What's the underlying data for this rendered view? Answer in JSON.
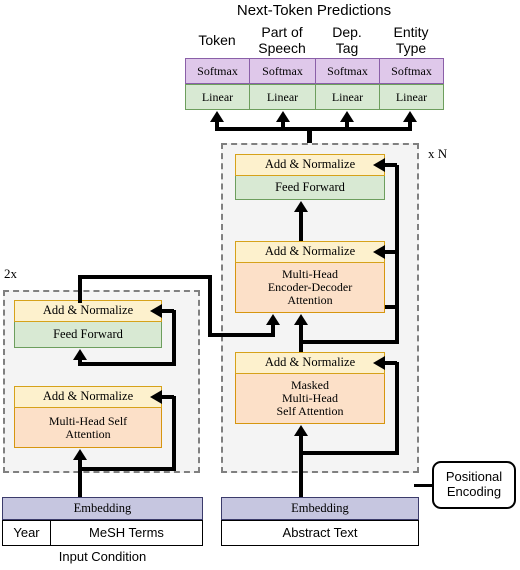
{
  "title": "Next-Token Predictions",
  "output_heads": {
    "columns": [
      {
        "label": "Token",
        "softmax": "Softmax",
        "linear": "Linear"
      },
      {
        "label": "Part of\nSpeech",
        "label_l1": "Part of",
        "label_l2": "Speech",
        "softmax": "Softmax",
        "linear": "Linear"
      },
      {
        "label": "Dep.\nTag",
        "label_l1": "Dep.",
        "label_l2": "Tag",
        "softmax": "Softmax",
        "linear": "Linear"
      },
      {
        "label": "Entity\nType",
        "label_l1": "Entity",
        "label_l2": "Type",
        "softmax": "Softmax",
        "linear": "Linear"
      }
    ]
  },
  "decoder": {
    "repeat_label": "x N",
    "top_block": {
      "addnorm": "Add & Normalize",
      "sub": "Feed Forward"
    },
    "mid_block": {
      "addnorm": "Add & Normalize",
      "sub_l1": "Multi-Head",
      "sub_l2": "Encoder-Decoder",
      "sub_l3": "Attention"
    },
    "bottom_block": {
      "addnorm": "Add & Normalize",
      "sub_l1": "Masked",
      "sub_l2": "Multi-Head",
      "sub_l3": "Self Attention"
    },
    "embedding": "Embedding",
    "input": "Abstract Text"
  },
  "encoder": {
    "repeat_label": "2x",
    "top_block": {
      "addnorm": "Add & Normalize",
      "sub": "Feed Forward"
    },
    "bottom_block": {
      "addnorm": "Add & Normalize",
      "sub_l1": "Multi-Head Self",
      "sub_l2": "Attention"
    },
    "embedding": "Embedding",
    "input_left": "Year",
    "input_right": "MeSH Terms",
    "caption": "Input Condition"
  },
  "positional_encoding": {
    "line1": "Positional",
    "line2": "Encoding"
  },
  "colors": {
    "softmax_fill": "#dfc8ea",
    "softmax_border": "#8a5fa8",
    "linear_fill": "#d8e9d3",
    "linear_border": "#6d9e5d",
    "addnorm_fill": "#fdf1cd",
    "addnorm_border": "#d6a21a",
    "attention_fill": "#fce0c8",
    "attention_border": "#d6960f",
    "embedding_fill": "#c6c6e0",
    "embedding_border": "#3b3b6b",
    "stack_fill": "#f4f4f4",
    "stack_border": "#808080",
    "connector": "#000000"
  }
}
